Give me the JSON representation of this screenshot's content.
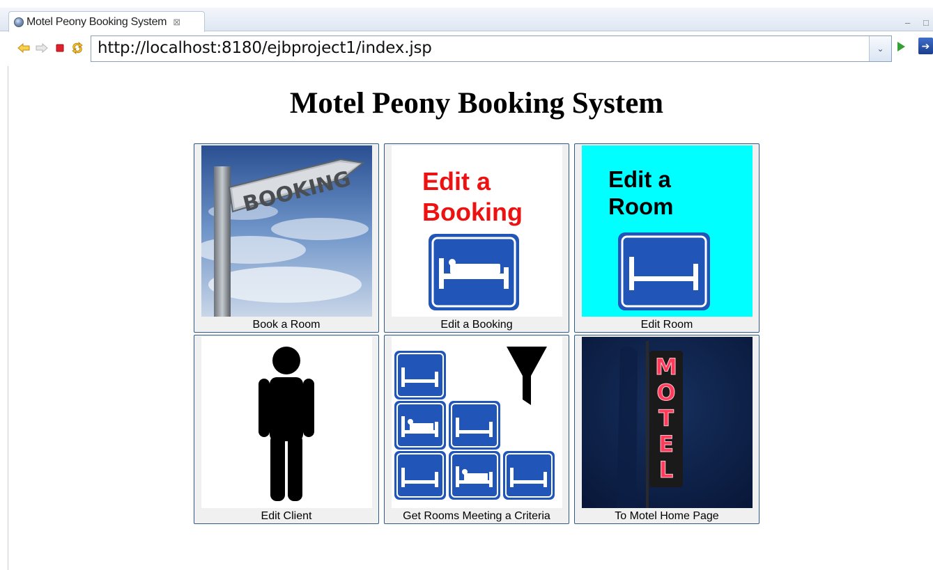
{
  "browser": {
    "tab_title": "Motel Peony Booking System",
    "tab_close": "⊠",
    "minimize": "–",
    "maximize": "□",
    "url": "http://localhost:8180/ejbproject1/index.jsp",
    "dropdown": "⌄"
  },
  "page": {
    "heading": "Motel Peony Booking System",
    "tiles": [
      {
        "label": "Book a Room",
        "image_text": "BOOKING"
      },
      {
        "label": "Edit a Booking",
        "image_text_1": "Edit a",
        "image_text_2": "Booking"
      },
      {
        "label": "Edit Room",
        "image_text_1": "Edit a",
        "image_text_2": "Room"
      },
      {
        "label": "Edit Client"
      },
      {
        "label": "Get Rooms Meeting a Criteria"
      },
      {
        "label": "To Motel Home Page",
        "image_text": [
          "M",
          "O",
          "T",
          "E",
          "L"
        ]
      }
    ]
  },
  "colors": {
    "bed_blue": "#2255b8",
    "edit_red": "#ee1111",
    "cyan": "#00ffff",
    "tile_border": "#2e5a87"
  },
  "icons": [
    "globe-icon",
    "back-icon",
    "forward-icon",
    "stop-icon",
    "refresh-icon",
    "go-icon",
    "go-external-icon"
  ]
}
